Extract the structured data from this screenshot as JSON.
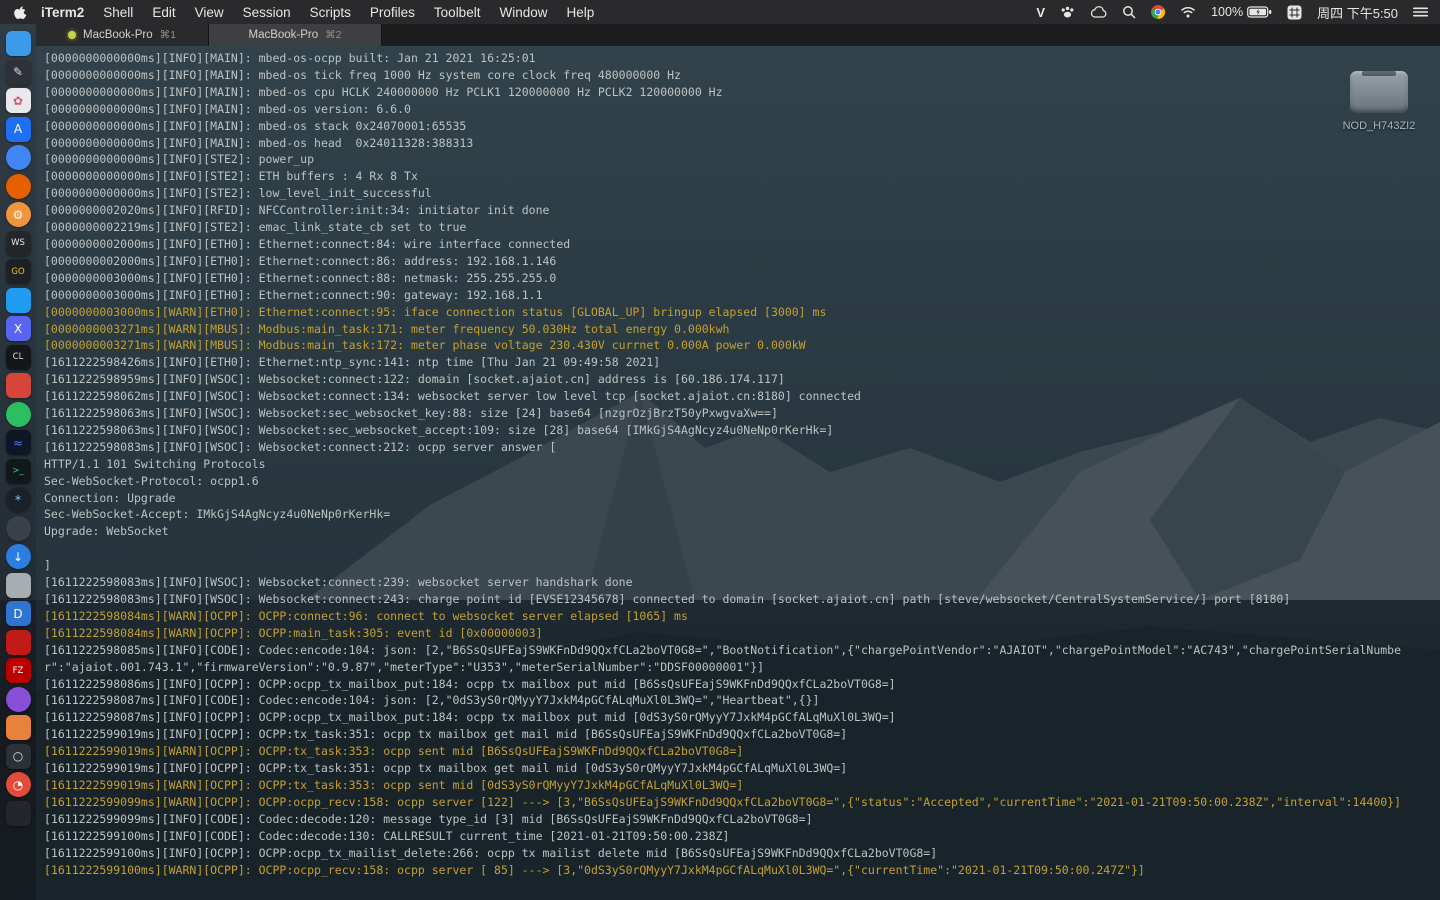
{
  "menu_bar": {
    "items": [
      "iTerm2",
      "Shell",
      "Edit",
      "View",
      "Session",
      "Scripts",
      "Profiles",
      "Toolbelt",
      "Window",
      "Help"
    ],
    "status": {
      "icons": [
        "v-logo-icon",
        "paw-icon",
        "cloud-icon",
        "search-icon",
        "chrome-icon",
        "wifi-icon"
      ],
      "battery_label": "100%",
      "clock": "周四 下午5:50"
    }
  },
  "window": {
    "tabs": [
      {
        "title": "MacBook-Pro",
        "shortcut": "⌘1",
        "indicator": true,
        "active": false
      },
      {
        "title": "MacBook-Pro",
        "shortcut": "⌘2",
        "indicator": false,
        "active": true
      }
    ]
  },
  "desktop": {
    "disk_label": "NOD_H743ZI2"
  },
  "colors": {
    "warn": "#c2a035",
    "info": "#bdc3c3",
    "tab_indicator": "#c6d64b"
  },
  "terminal": {
    "lines": [
      {
        "l": "info",
        "t": "[0000000000000ms][INFO][MAIN]: mbed-os-ocpp built: Jan 21 2021 16:25:01"
      },
      {
        "l": "info",
        "t": "[0000000000000ms][INFO][MAIN]: mbed-os tick freq 1000 Hz system core clock freq 480000000 Hz"
      },
      {
        "l": "info",
        "t": "[0000000000000ms][INFO][MAIN]: mbed-os cpu HCLK 240000000 Hz PCLK1 120000000 Hz PCLK2 120000000 Hz"
      },
      {
        "l": "info",
        "t": "[0000000000000ms][INFO][MAIN]: mbed-os version: 6.6.0"
      },
      {
        "l": "info",
        "t": "[0000000000000ms][INFO][MAIN]: mbed-os stack 0x24070001:65535"
      },
      {
        "l": "info",
        "t": "[0000000000000ms][INFO][MAIN]: mbed-os head  0x24011328:388313"
      },
      {
        "l": "info",
        "t": "[0000000000000ms][INFO][STE2]: power_up"
      },
      {
        "l": "info",
        "t": "[0000000000000ms][INFO][STE2]: ETH buffers : 4 Rx 8 Tx"
      },
      {
        "l": "info",
        "t": "[0000000000000ms][INFO][STE2]: low_level_init_successful"
      },
      {
        "l": "info",
        "t": "[0000000002020ms][INFO][RFID]: NFCController:init:34: initiator init done"
      },
      {
        "l": "info",
        "t": "[0000000002219ms][INFO][STE2]: emac_link_state_cb set to true"
      },
      {
        "l": "info",
        "t": "[0000000002000ms][INFO][ETH0]: Ethernet:connect:84: wire interface connected"
      },
      {
        "l": "info",
        "t": "[0000000002000ms][INFO][ETH0]: Ethernet:connect:86: address: 192.168.1.146"
      },
      {
        "l": "info",
        "t": "[0000000003000ms][INFO][ETH0]: Ethernet:connect:88: netmask: 255.255.255.0"
      },
      {
        "l": "info",
        "t": "[0000000003000ms][INFO][ETH0]: Ethernet:connect:90: gateway: 192.168.1.1"
      },
      {
        "l": "warn",
        "t": "[0000000003000ms][WARN][ETH0]: Ethernet:connect:95: iface connection status [GLOBAL_UP] bringup elapsed [3000] ms"
      },
      {
        "l": "warn",
        "t": "[0000000003271ms][WARN][MBUS]: Modbus:main_task:171: meter frequency 50.030Hz total energy 0.000kwh"
      },
      {
        "l": "warn",
        "t": "[0000000003271ms][WARN][MBUS]: Modbus:main_task:172: meter phase voltage 230.430V currnet 0.000A power 0.000kW"
      },
      {
        "l": "info",
        "t": "[1611222598426ms][INFO][ETH0]: Ethernet:ntp_sync:141: ntp time [Thu Jan 21 09:49:58 2021]"
      },
      {
        "l": "info",
        "t": "[1611222598959ms][INFO][WSOC]: Websocket:connect:122: domain [socket.ajaiot.cn] address is [60.186.174.117]"
      },
      {
        "l": "info",
        "t": "[1611222598062ms][INFO][WSOC]: Websocket:connect:134: websocket server low level tcp [socket.ajaiot.cn:8180] connected"
      },
      {
        "l": "info",
        "t": "[1611222598063ms][INFO][WSOC]: Websocket:sec_websocket_key:88: size [24] base64 [nzgrOzjBrzT50yPxwgvaXw==]"
      },
      {
        "l": "info",
        "t": "[1611222598063ms][INFO][WSOC]: Websocket:sec_websocket_accept:109: size [28] base64 [IMkGjS4AgNcyz4u0NeNp0rKerHk=]"
      },
      {
        "l": "info",
        "t": "[1611222598083ms][INFO][WSOC]: Websocket:connect:212: ocpp server answer ["
      },
      {
        "l": "info",
        "t": "HTTP/1.1 101 Switching Protocols"
      },
      {
        "l": "info",
        "t": "Sec-WebSocket-Protocol: ocpp1.6"
      },
      {
        "l": "info",
        "t": "Connection: Upgrade"
      },
      {
        "l": "info",
        "t": "Sec-WebSocket-Accept: IMkGjS4AgNcyz4u0NeNp0rKerHk="
      },
      {
        "l": "info",
        "t": "Upgrade: WebSocket"
      },
      {
        "l": "info",
        "t": ""
      },
      {
        "l": "info",
        "t": "]"
      },
      {
        "l": "info",
        "t": "[1611222598083ms][INFO][WSOC]: Websocket:connect:239: websocket server handshark done"
      },
      {
        "l": "info",
        "t": "[1611222598083ms][INFO][WSOC]: Websocket:connect:243: charge point id [EVSE12345678] connected to domain [socket.ajaiot.cn] path [steve/websocket/CentralSystemService/] port [8180]"
      },
      {
        "l": "warn",
        "t": "[1611222598084ms][WARN][OCPP]: OCPP:connect:96: connect to websocket server elapsed [1065] ms"
      },
      {
        "l": "warn",
        "t": "[1611222598084ms][WARN][OCPP]: OCPP:main_task:305: event id [0x00000003]"
      },
      {
        "l": "info",
        "t": "[1611222598085ms][INFO][CODE]: Codec:encode:104: json: [2,\"B6SsQsUFEajS9WKFnDd9QQxfCLa2boVT0G8=\",\"BootNotification\",{\"chargePointVendor\":\"AJAIOT\",\"chargePointModel\":\"AC743\",\"chargePointSerialNumber\":\"ajaiot.001.743.1\",\"firmwareVersion\":\"0.9.87\",\"meterType\":\"U353\",\"meterSerialNumber\":\"DDSF00000001\"}]"
      },
      {
        "l": "info",
        "t": "[1611222598086ms][INFO][OCPP]: OCPP:ocpp_tx_mailbox_put:184: ocpp tx mailbox put mid [B6SsQsUFEajS9WKFnDd9QQxfCLa2boVT0G8=]"
      },
      {
        "l": "info",
        "t": "[1611222598087ms][INFO][CODE]: Codec:encode:104: json: [2,\"0dS3yS0rQMyyY7JxkM4pGCfALqMuXl0L3WQ=\",\"Heartbeat\",{}]"
      },
      {
        "l": "info",
        "t": "[1611222598087ms][INFO][OCPP]: OCPP:ocpp_tx_mailbox_put:184: ocpp tx mailbox put mid [0dS3yS0rQMyyY7JxkM4pGCfALqMuXl0L3WQ=]"
      },
      {
        "l": "info",
        "t": "[1611222599019ms][INFO][OCPP]: OCPP:tx_task:351: ocpp tx mailbox get mail mid [B6SsQsUFEajS9WKFnDd9QQxfCLa2boVT0G8=]"
      },
      {
        "l": "warn",
        "t": "[1611222599019ms][WARN][OCPP]: OCPP:tx_task:353: ocpp sent mid [B6SsQsUFEajS9WKFnDd9QQxfCLa2boVT0G8=]"
      },
      {
        "l": "info",
        "t": "[1611222599019ms][INFO][OCPP]: OCPP:tx_task:351: ocpp tx mailbox get mail mid [0dS3yS0rQMyyY7JxkM4pGCfALqMuXl0L3WQ=]"
      },
      {
        "l": "warn",
        "t": "[1611222599019ms][WARN][OCPP]: OCPP:tx_task:353: ocpp sent mid [0dS3yS0rQMyyY7JxkM4pGCfALqMuXl0L3WQ=]"
      },
      {
        "l": "warn",
        "t": "[1611222599099ms][WARN][OCPP]: OCPP:ocpp_recv:158: ocpp server [122] ---> [3,\"B6SsQsUFEajS9WKFnDd9QQxfCLa2boVT0G8=\",{\"status\":\"Accepted\",\"currentTime\":\"2021-01-21T09:50:00.238Z\",\"interval\":14400}]"
      },
      {
        "l": "info",
        "t": "[1611222599099ms][INFO][CODE]: Codec:decode:120: message type_id [3] mid [B6SsQsUFEajS9WKFnDd9QQxfCLa2boVT0G8=]"
      },
      {
        "l": "info",
        "t": "[1611222599100ms][INFO][CODE]: Codec:decode:130: CALLRESULT current_time [2021-01-21T09:50:00.238Z]"
      },
      {
        "l": "info",
        "t": "[1611222599100ms][INFO][OCPP]: OCPP:ocpp_tx_mailist_delete:266: ocpp tx mailist delete mid [B6SsQsUFEajS9WKFnDd9QQxfCLa2boVT0G8=]"
      },
      {
        "l": "warn",
        "t": "[1611222599100ms][WARN][OCPP]: OCPP:ocpp_recv:158: ocpp server [ 85] ---> [3,\"0dS3yS0rQMyyY7JxkM4pGCfALqMuXl0L3WQ=\",{\"currentTime\":\"2021-01-21T09:50:00.247Z\"}]"
      }
    ]
  },
  "dock": {
    "items": [
      {
        "name": "finder",
        "glyph": "",
        "bg": "#3c9ae8",
        "shape": "sq"
      },
      {
        "name": "design-tool",
        "glyph": "✎",
        "bg": "#2e3238",
        "fg": "#dddddd",
        "shape": "sq"
      },
      {
        "name": "photos",
        "glyph": "✿",
        "bg": "#e9e9ed",
        "fg": "#d8566a",
        "shape": "sq"
      },
      {
        "name": "app-store",
        "glyph": "A",
        "bg": "#1f6ff2",
        "fg": "#ffffff",
        "shape": "sq"
      },
      {
        "name": "chrome",
        "glyph": "",
        "bg": "#4285f4",
        "shape": "ci"
      },
      {
        "name": "firefox",
        "glyph": "",
        "bg": "#e66000",
        "shape": "ci"
      },
      {
        "name": "settings-gear",
        "glyph": "⚙",
        "bg": "#f0953c",
        "fg": "#ffffff",
        "shape": "ci"
      },
      {
        "name": "ws-app",
        "glyph": "WS",
        "bg": "#23262b",
        "fg": "#e8e8e8",
        "shape": "sq"
      },
      {
        "name": "go-app",
        "glyph": "GO",
        "bg": "#1d2025",
        "fg": "#f5c518",
        "shape": "sq"
      },
      {
        "name": "vscode",
        "glyph": "",
        "bg": "#1f9cf0",
        "shape": "sq"
      },
      {
        "name": "x-app",
        "glyph": "X",
        "bg": "#5865f2",
        "fg": "#ffffff",
        "shape": "sq"
      },
      {
        "name": "cl-app",
        "glyph": "CL",
        "bg": "#14161a",
        "fg": "#dddddd",
        "shape": "sq"
      },
      {
        "name": "red-blue-app",
        "glyph": "",
        "bg": "#d6453a",
        "shape": "sq"
      },
      {
        "name": "green-app",
        "glyph": "",
        "bg": "#2dbe60",
        "shape": "ci"
      },
      {
        "name": "waveform-app",
        "glyph": "≈",
        "bg": "#0f1625",
        "fg": "#3b82f6",
        "shape": "sq"
      },
      {
        "name": "terminal-app",
        "glyph": ">_",
        "bg": "#10181a",
        "fg": "#38d05e",
        "shape": "sq"
      },
      {
        "name": "helm-app",
        "glyph": "*",
        "bg": "#1c2027",
        "fg": "#88ccff",
        "shape": "ci"
      },
      {
        "name": "gray-circle-app",
        "glyph": "",
        "bg": "#3a4049",
        "shape": "ci"
      },
      {
        "name": "downloads",
        "glyph": "↓",
        "bg": "#2a7de1",
        "fg": "#ffffff",
        "shape": "ci"
      },
      {
        "name": "trash",
        "glyph": "",
        "bg": "#a7adb3",
        "shape": "sq"
      },
      {
        "name": "d-app",
        "glyph": "D",
        "bg": "#2f74d0",
        "fg": "#ffffff",
        "shape": "sq"
      },
      {
        "name": "acrobat",
        "glyph": "",
        "bg": "#c11b17",
        "shape": "sq"
      },
      {
        "name": "filezilla",
        "glyph": "FZ",
        "bg": "#bb0000",
        "fg": "#ffffff",
        "shape": "sq"
      },
      {
        "name": "purple-app",
        "glyph": "",
        "bg": "#8a4fd8",
        "shape": "ci"
      },
      {
        "name": "orange-box-app",
        "glyph": "",
        "bg": "#e8813c",
        "shape": "sq"
      },
      {
        "name": "search-app",
        "glyph": "○",
        "bg": "#2c3137",
        "fg": "#dfe3e6",
        "shape": "sq"
      },
      {
        "name": "dial-app",
        "glyph": "◔",
        "bg": "#e04b3a",
        "fg": "#ffffff",
        "shape": "ci"
      },
      {
        "name": "dark-box-app",
        "glyph": "",
        "bg": "#23262c",
        "shape": "sq"
      }
    ]
  }
}
